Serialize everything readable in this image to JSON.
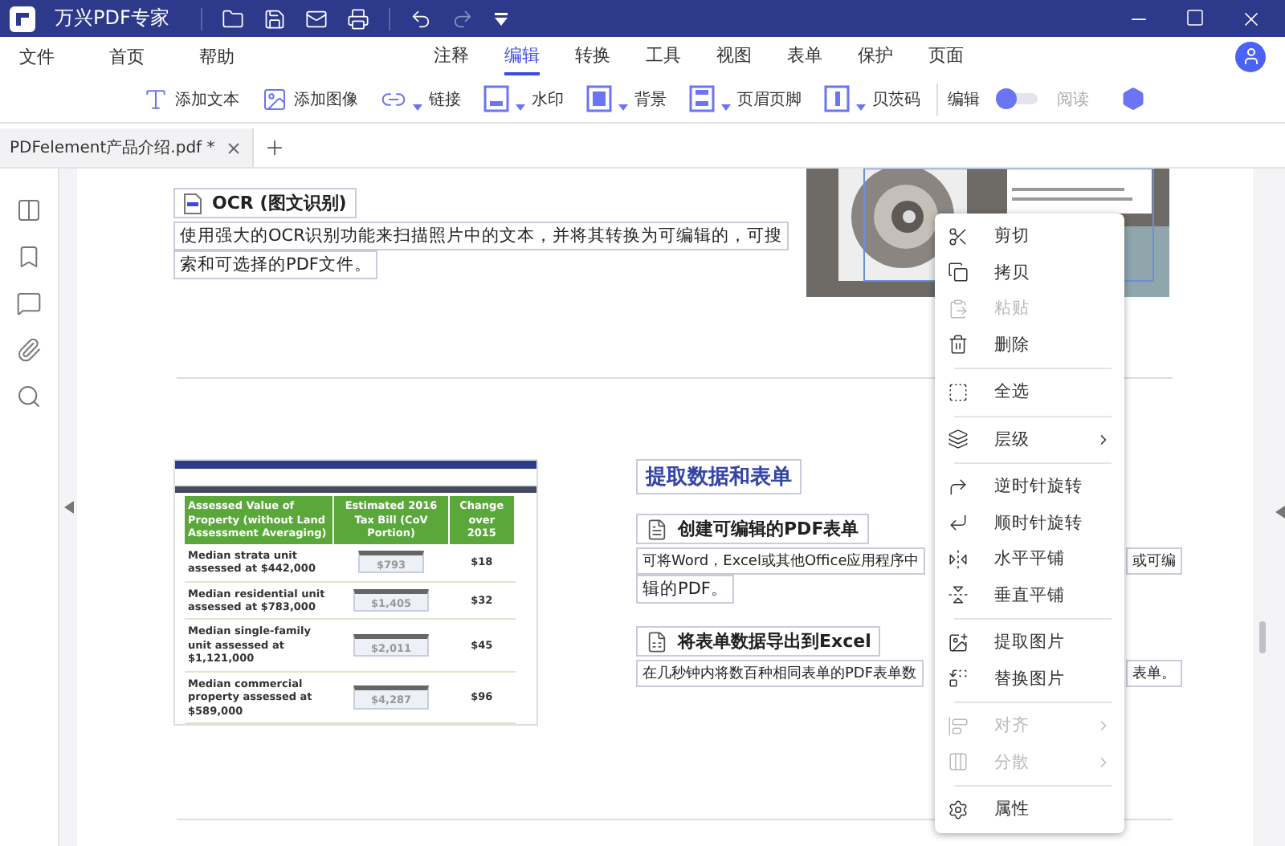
{
  "window": {
    "title": "万兴PDF专家"
  },
  "menu_left": [
    "文件",
    "首页",
    "帮助"
  ],
  "ribbon_tabs": [
    {
      "label": "注释",
      "selected": false
    },
    {
      "label": "编辑",
      "selected": true
    },
    {
      "label": "转换",
      "selected": false
    },
    {
      "label": "工具",
      "selected": false
    },
    {
      "label": "视图",
      "selected": false
    },
    {
      "label": "表单",
      "selected": false
    },
    {
      "label": "保护",
      "selected": false
    },
    {
      "label": "页面",
      "selected": false
    }
  ],
  "toolbar": [
    {
      "label": "添加文本",
      "dropdown": false
    },
    {
      "label": "添加图像",
      "dropdown": false
    },
    {
      "label": "链接",
      "dropdown": true
    },
    {
      "label": "水印",
      "dropdown": true
    },
    {
      "label": "背景",
      "dropdown": true
    },
    {
      "label": "页眉页脚",
      "dropdown": true
    },
    {
      "label": "贝茨码",
      "dropdown": true
    }
  ],
  "mode_switch": {
    "left_label": "编辑",
    "right_label": "阅读",
    "read_mode": false
  },
  "doc_tabs": [
    {
      "label": "PDFelement产品介绍.pdf *",
      "selected": true
    }
  ],
  "ocr": {
    "heading": "OCR (图文识别)",
    "lines": [
      "使用强大的OCR识别功能来扫描照片中的文本，并将其转换为可编辑的，可搜",
      "索和可选择的PDF文件。"
    ]
  },
  "forms": {
    "heading": "提取数据和表单",
    "blocks": [
      {
        "title": "创建可编辑的PDF表单",
        "line1_start": "可将Word，Excel或其他Office应用程序中",
        "line1_end": "或可编",
        "line2": "辑的PDF。"
      },
      {
        "title": "将表单数据导出到Excel",
        "line1_start": "在几秒钟内将数百种相同表单的PDF表单数",
        "line1_end": "表单。"
      }
    ]
  },
  "embedded_screenshot": {
    "columns": [
      "Assessed Value of Property (without Land Assessment Averaging)",
      "Estimated 2016 Tax Bill (CoV Portion)",
      "Change over 2015"
    ],
    "rows": [
      [
        "Median strata unit assessed at $442,000",
        "$793",
        "$18"
      ],
      [
        "Median residential unit assessed at $783,000",
        "$1,405",
        "$32"
      ],
      [
        "Median single-family unit assessed at $1,121,000",
        "$2,011",
        "$45"
      ],
      [
        "Median commercial property assessed at $589,000",
        "$4,287",
        "$96"
      ]
    ]
  },
  "context_menu": [
    [
      {
        "label": "剪切",
        "disabled": false,
        "submenu": false
      },
      {
        "label": "拷贝",
        "disabled": false,
        "submenu": false
      },
      {
        "label": "粘贴",
        "disabled": true,
        "submenu": false
      },
      {
        "label": "删除",
        "disabled": false,
        "submenu": false
      }
    ],
    [
      {
        "label": "全选",
        "disabled": false,
        "submenu": false
      }
    ],
    [
      {
        "label": "层级",
        "disabled": false,
        "submenu": true
      }
    ],
    [
      {
        "label": "逆时针旋转",
        "disabled": false,
        "submenu": false
      },
      {
        "label": "顺时针旋转",
        "disabled": false,
        "submenu": false
      },
      {
        "label": "水平平铺",
        "disabled": false,
        "submenu": false
      },
      {
        "label": "垂直平铺",
        "disabled": false,
        "submenu": false
      }
    ],
    [
      {
        "label": "提取图片",
        "disabled": false,
        "submenu": false
      },
      {
        "label": "替换图片",
        "disabled": false,
        "submenu": false
      }
    ],
    [
      {
        "label": "对齐",
        "disabled": true,
        "submenu": true
      },
      {
        "label": "分散",
        "disabled": true,
        "submenu": true
      }
    ],
    [
      {
        "label": "属性",
        "disabled": false,
        "submenu": false
      }
    ]
  ]
}
